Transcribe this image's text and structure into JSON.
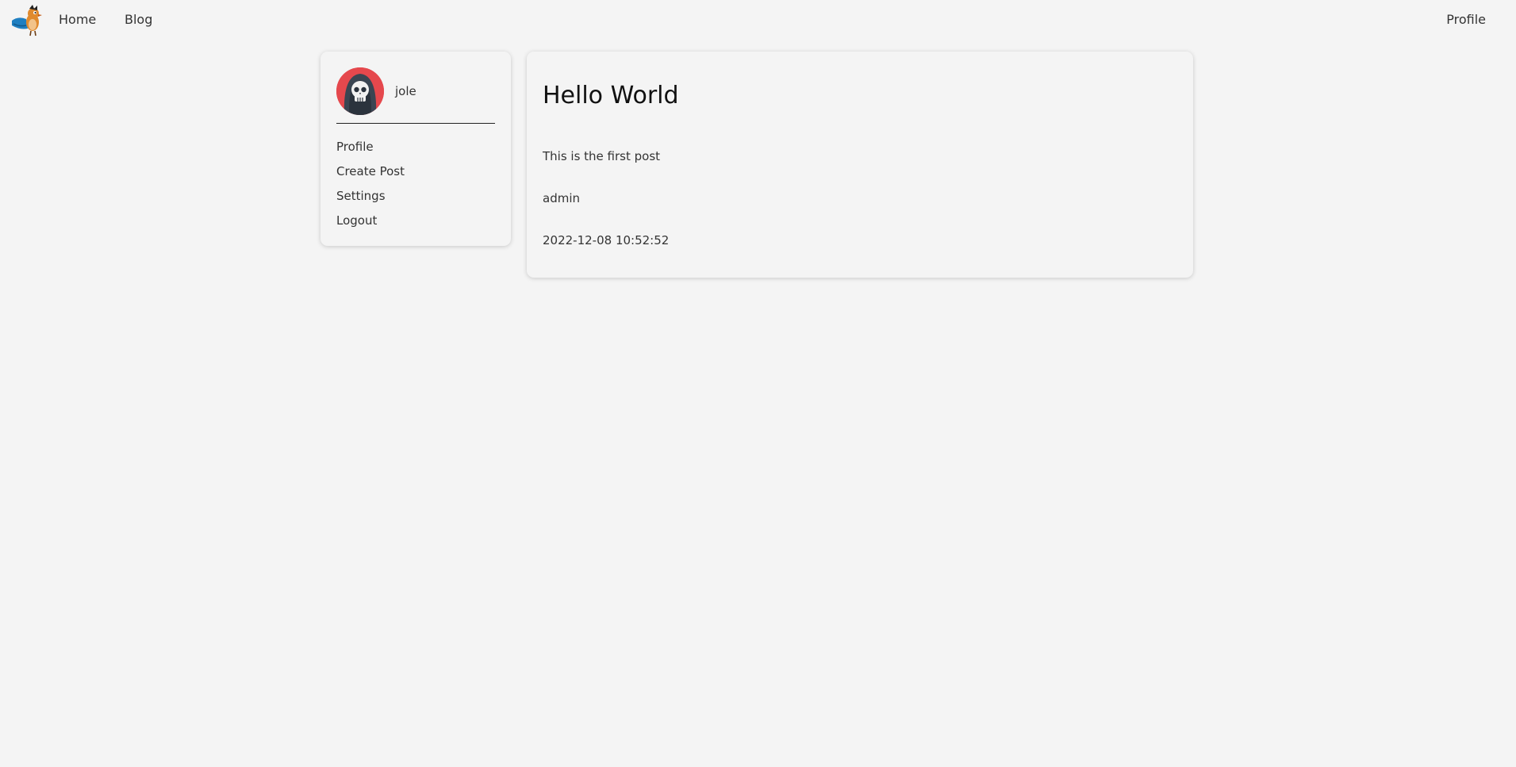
{
  "nav": {
    "logo_icon": "bird-mascot-icon",
    "home_label": "Home",
    "blog_label": "Blog",
    "profile_label": "Profile"
  },
  "sidebar": {
    "avatar_icon": "skull-avatar-icon",
    "username": "jole",
    "items": [
      {
        "label": "Profile"
      },
      {
        "label": "Create Post"
      },
      {
        "label": "Settings"
      },
      {
        "label": "Logout"
      }
    ]
  },
  "post": {
    "title": "Hello World",
    "body": "This is the first post",
    "author": "admin",
    "date": "2022-12-08 10:52:52"
  },
  "colors": {
    "background": "#f4f4f4",
    "avatar_bg": "#e5484d",
    "avatar_hood": "#3a4552",
    "logo_blue": "#1f7fc1",
    "logo_orange": "#e08a2e"
  }
}
